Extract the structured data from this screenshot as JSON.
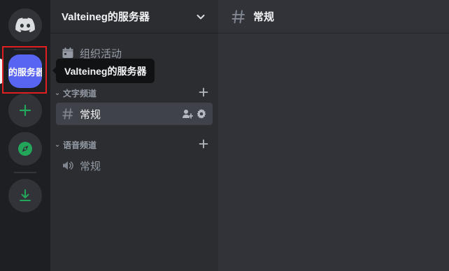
{
  "rail": {
    "home_icon": "discord-logo-icon",
    "server_label": "的服务器",
    "add_icon": "plus-icon",
    "explore_icon": "compass-icon",
    "download_icon": "download-icon",
    "colors": {
      "accent": "#5865f2",
      "green": "#23a55a",
      "selection_box": "#e02020"
    }
  },
  "sidebar": {
    "guild_name": "Valteineg的服务器",
    "events_label": "组织活动",
    "categories": [
      {
        "label": "文字频道",
        "channels": [
          {
            "type": "text",
            "name": "常规",
            "selected": true
          }
        ]
      },
      {
        "label": "语音频道",
        "channels": [
          {
            "type": "voice",
            "name": "常规",
            "selected": false
          }
        ]
      }
    ]
  },
  "main": {
    "channel_name": "常规"
  },
  "tooltip": {
    "text": "Valteineg的服务器"
  }
}
